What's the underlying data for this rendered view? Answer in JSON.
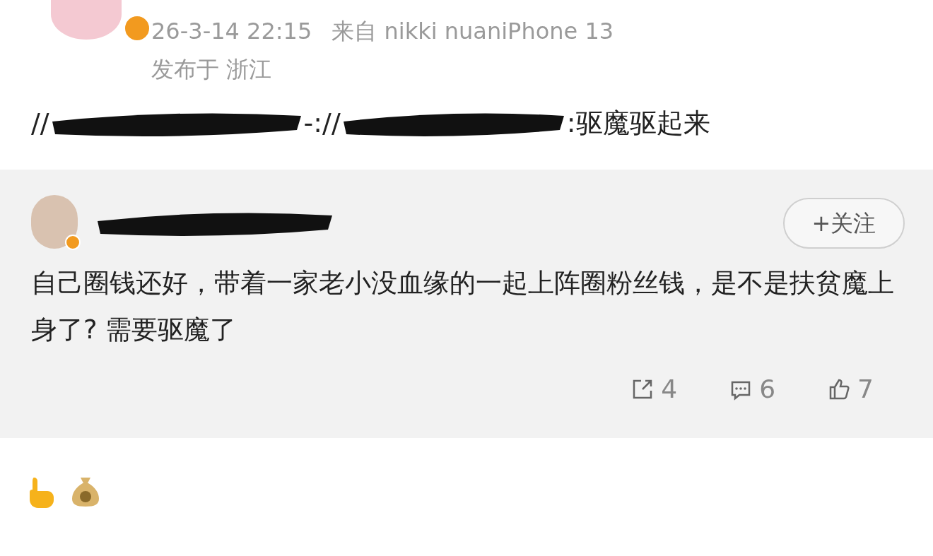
{
  "post": {
    "time": "26-3-14 22:15",
    "source": "来自 nikki nuaniPhone 13",
    "location": "发布于 浙江",
    "repost_text": [
      {
        "kind": "text",
        "text": "//"
      },
      {
        "kind": "redaction"
      },
      {
        "kind": "text",
        "text": "-://"
      },
      {
        "kind": "redaction"
      },
      {
        "kind": "text",
        "text": ":驱魔驱起来"
      }
    ]
  },
  "quoted": {
    "follow_button": "+关注",
    "text": "自己圈钱还好，带着一家老小没血缘的一起上阵圈粉丝钱，是不是扶贫魔上身了? 需要驱魔了",
    "actions": [
      {
        "kind": "share",
        "count": "4"
      },
      {
        "kind": "comment",
        "count": "6"
      },
      {
        "kind": "like",
        "count": "7"
      }
    ]
  }
}
